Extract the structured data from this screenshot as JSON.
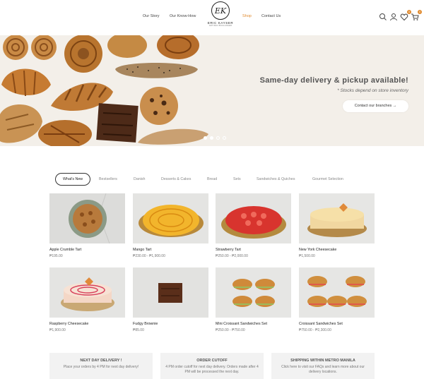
{
  "header": {
    "nav_left": [
      "Our Story",
      "Our Know-How"
    ],
    "nav_right": [
      "Shop",
      "Contact Us"
    ],
    "logo_mark": "EK",
    "logo_name": "ERIC KAYSER",
    "logo_sub": "ARTISAN BOULANGER",
    "cart_badge": "0",
    "wishlist_badge": "0",
    "accent_color": "#e08a2e"
  },
  "hero": {
    "title": "Same-day delivery & pickup available!",
    "subtitle": "* Stocks depend on store inventory",
    "button": "Contact our branches →",
    "slides": 4,
    "active_slide": 1
  },
  "tabs": [
    "What's New",
    "Bestsellers",
    "Danish",
    "Desserts & Cakes",
    "Bread",
    "Sets",
    "Sandwiches & Quiches",
    "Gourmet Selection"
  ],
  "products": [
    {
      "name": "Apple Crumble Tart",
      "price": "₱195.00"
    },
    {
      "name": "Mango Tart",
      "price": "₱230.00 - ₱1,900.00"
    },
    {
      "name": "Strawberry Tart",
      "price": "₱250.00 - ₱2,000.00"
    },
    {
      "name": "New York Cheesecake",
      "price": "₱1,500.00"
    },
    {
      "name": "Raspberry Cheesecake",
      "price": "₱1,900.00"
    },
    {
      "name": "Fudgy Brownie",
      "price": "₱85.00"
    },
    {
      "name": "Mini Croissant Sandwiches Set",
      "price": "₱250.00 - ₱750.00"
    },
    {
      "name": "Croissant Sandwiches Set",
      "price": "₱750.00 - ₱2,300.00"
    }
  ],
  "info": [
    {
      "title": "NEXT DAY DELIVERY !",
      "text": "Place your orders by 4 PM for next day delivery!"
    },
    {
      "title": "ORDER CUTOFF",
      "text": "4 PM order cutoff for next day delivery. Orders made after 4 PM will be processed the next day."
    },
    {
      "title": "SHIPPING WITHIN METRO MANILA",
      "text": "Click here to visit our FAQs and learn more about our delivery locations."
    }
  ]
}
